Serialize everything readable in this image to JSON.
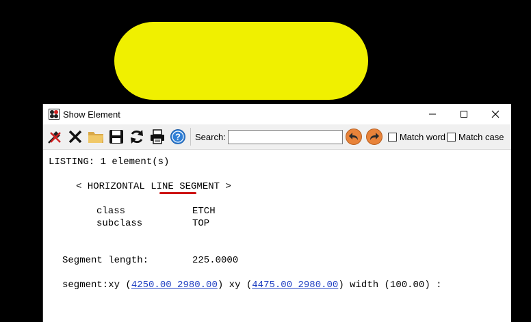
{
  "window": {
    "title": "Show Element",
    "controls": [
      "minimize",
      "maximize",
      "close"
    ]
  },
  "toolbar": {
    "search_label": "Search:",
    "search_value": "",
    "match_word_label": "Match word",
    "match_case_label": "Match case",
    "icons": [
      "pin-icon",
      "close-x-icon",
      "folder-icon",
      "save-icon",
      "refresh-icon",
      "print-icon",
      "help-icon",
      "back-arrow-icon",
      "forward-arrow-icon"
    ]
  },
  "listing": {
    "header": "LISTING: 1 element(s)",
    "element_type_prefix": "< HORIZONTAL ",
    "element_type_highlight": "LINE",
    "element_type_suffix": " SEGMENT >",
    "class_label": "class",
    "class_value": "ETCH",
    "subclass_label": "subclass",
    "subclass_value": "TOP",
    "segment_length_label": "Segment length:",
    "segment_length_value": "225.0000",
    "segment_prefix": "segment:xy (",
    "xy1": "4250.00 2980.00",
    "segment_mid": ") xy (",
    "xy2": "4475.00 2980.00",
    "segment_suffix": ") width (100.00) :"
  },
  "colors": {
    "background": "#000000",
    "pad": "#f0f000",
    "link": "#1f3fc2",
    "nav_button": "#e8833a",
    "spell_underline": "#cc1111"
  }
}
